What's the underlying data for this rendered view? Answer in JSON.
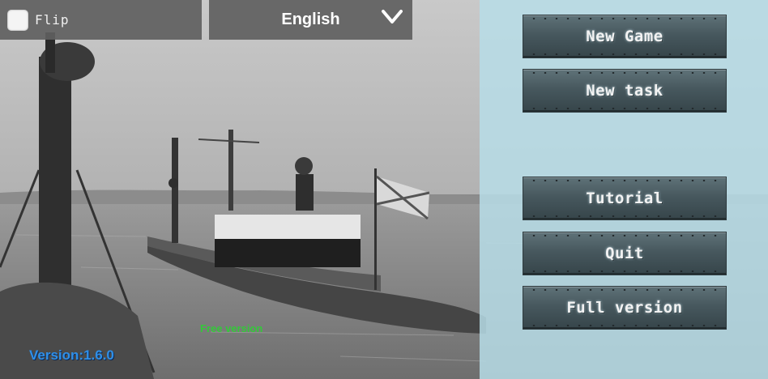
{
  "top_bar": {
    "flip_label": "Flip",
    "flip_checked": false,
    "language_selected": "English"
  },
  "menu": {
    "buttons": [
      {
        "label": "New Game"
      },
      {
        "label": "New task"
      },
      {
        "label": "Tutorial"
      },
      {
        "label": "Quit"
      },
      {
        "label": "Full version"
      }
    ]
  },
  "footer": {
    "free_version": "Free version",
    "version": "Version:1.6.0"
  },
  "icons": {
    "flip_checkbox": "checkbox-icon",
    "language_dropdown": "chevron-down-icon"
  },
  "colors": {
    "overlay_panel": "#b7dde8",
    "button_bg": "#47585e",
    "free_version_text": "#34c83a",
    "version_text": "#2f8fe8"
  }
}
